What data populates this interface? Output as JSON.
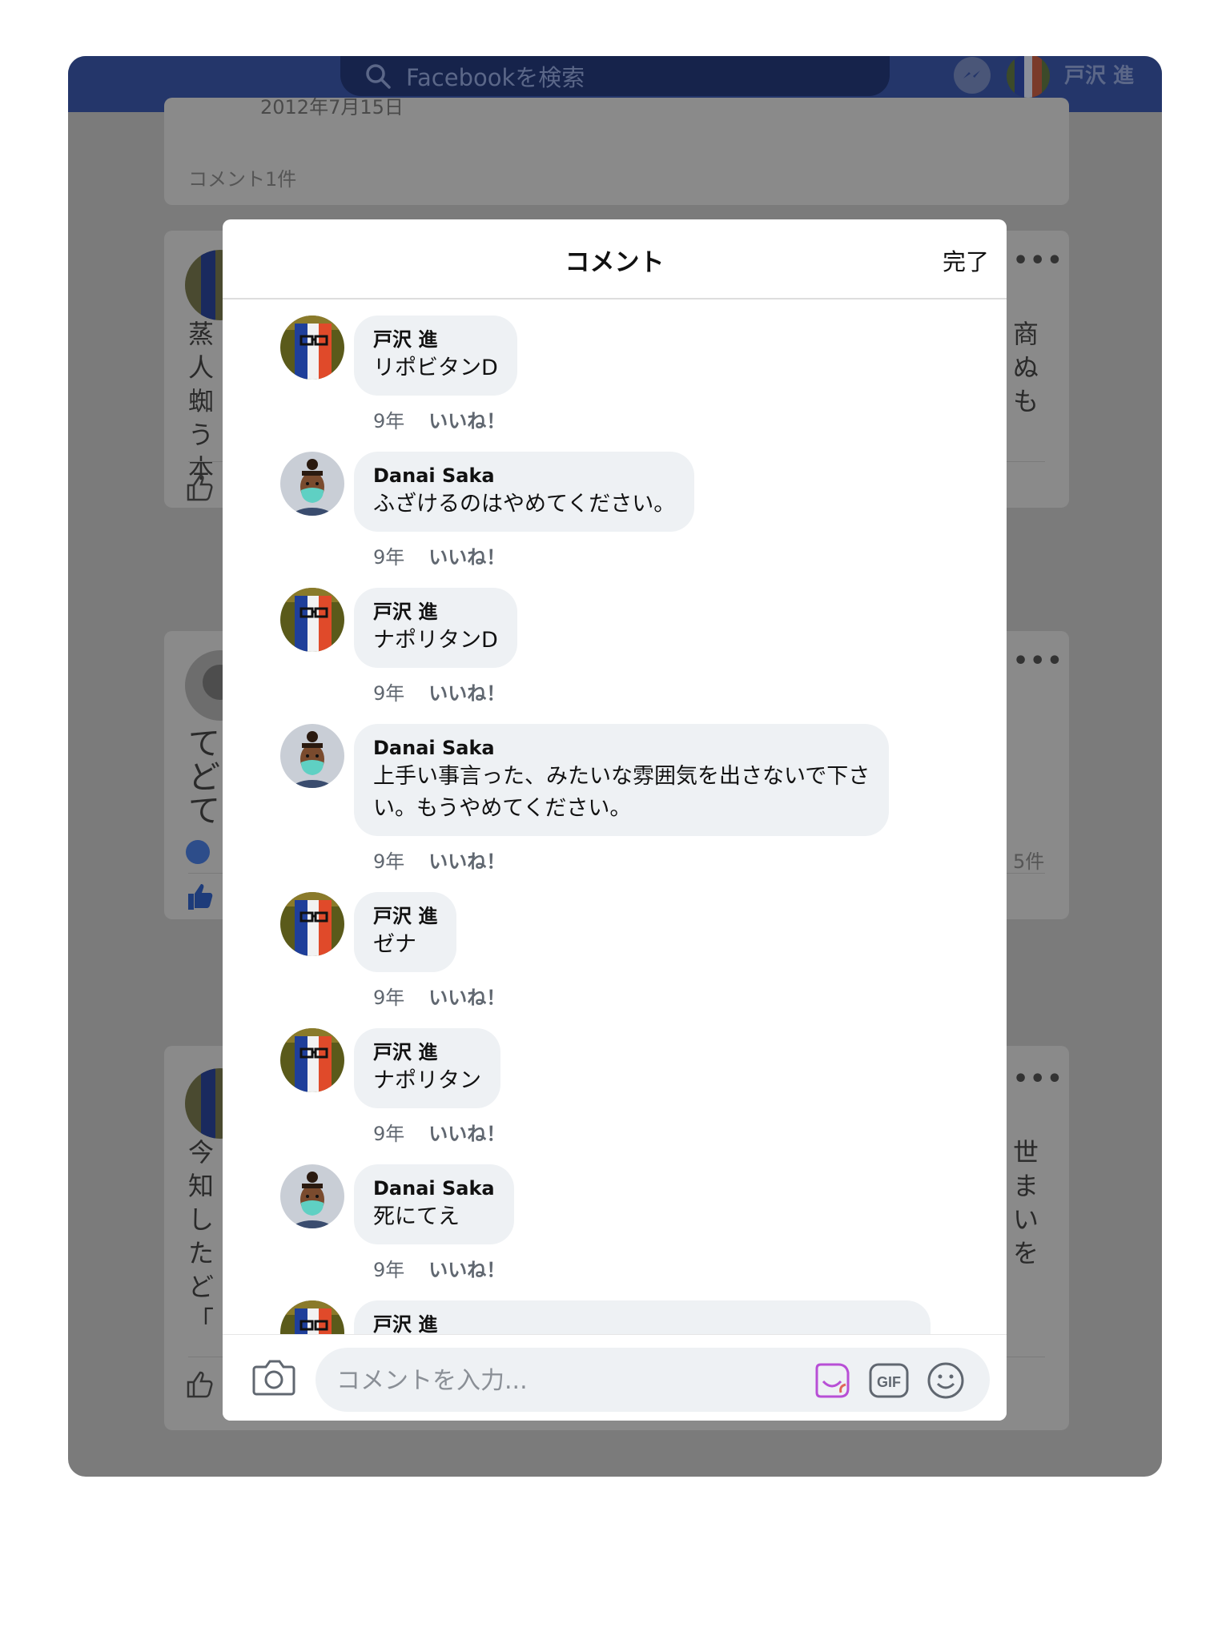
{
  "topbar": {
    "search_placeholder": "Facebookを検索",
    "user_name": "戸沢 進"
  },
  "background_feed": {
    "card1_date": "2012年7月15日",
    "card1_comment_count": "コメント1件",
    "card2_text_left": [
      "蒸",
      "人",
      "蜘",
      "う",
      "本"
    ],
    "card2_text_right": [
      "商",
      "ぬ",
      "も"
    ],
    "card3_text_left": [
      "て",
      "ど",
      "て"
    ],
    "card3_count_right": "5件",
    "card4_text_left": [
      "今",
      "知",
      "し",
      "た",
      "ど",
      "「"
    ],
    "card4_text_right": [
      "世",
      "ま",
      "い",
      "を"
    ]
  },
  "modal": {
    "title": "コメント",
    "done_label": "完了",
    "comments": [
      {
        "author": "戸沢 進",
        "text_lines": [
          "リポビタンD"
        ],
        "time": "9年",
        "like_label": "いいね！",
        "avatar": "flag-avatar"
      },
      {
        "author": "Danai Saka",
        "text_lines": [
          "ふざけるのはやめてください。"
        ],
        "time": "9年",
        "like_label": "いいね！",
        "avatar": "masked-avatar"
      },
      {
        "author": "戸沢 進",
        "text_lines": [
          "ナポリタンD"
        ],
        "time": "9年",
        "like_label": "いいね！",
        "avatar": "flag-avatar"
      },
      {
        "author": "Danai Saka",
        "text_lines": [
          "上手い事言った、みたいな雰囲気を出さないで下さ",
          "い。もうやめてください。"
        ],
        "time": "9年",
        "like_label": "いいね！",
        "avatar": "masked-avatar"
      },
      {
        "author": "戸沢 進",
        "text_lines": [
          "ゼナ"
        ],
        "time": "9年",
        "like_label": "いいね！",
        "avatar": "flag-avatar"
      },
      {
        "author": "戸沢 進",
        "text_lines": [
          "ナポリタン"
        ],
        "time": "9年",
        "like_label": "いいね！",
        "avatar": "flag-avatar"
      },
      {
        "author": "Danai Saka",
        "text_lines": [
          "死にてえ"
        ],
        "time": "9年",
        "like_label": "いいね！",
        "avatar": "masked-avatar"
      },
      {
        "author": "戸沢 進",
        "text_lines": [],
        "time": "",
        "like_label": "",
        "avatar": "flag-avatar"
      }
    ],
    "composer": {
      "placeholder": "コメントを入力...",
      "icons": [
        "camera-icon",
        "sticker-icon",
        "gif-icon",
        "emoji-icon"
      ],
      "gif_label": "GIF"
    }
  },
  "colors": {
    "topbar": "#24366a",
    "overlay": "#7b7b7b",
    "bubble": "#eef1f4",
    "meta_text": "#606770",
    "sticker_accent": "#b84fd6"
  }
}
